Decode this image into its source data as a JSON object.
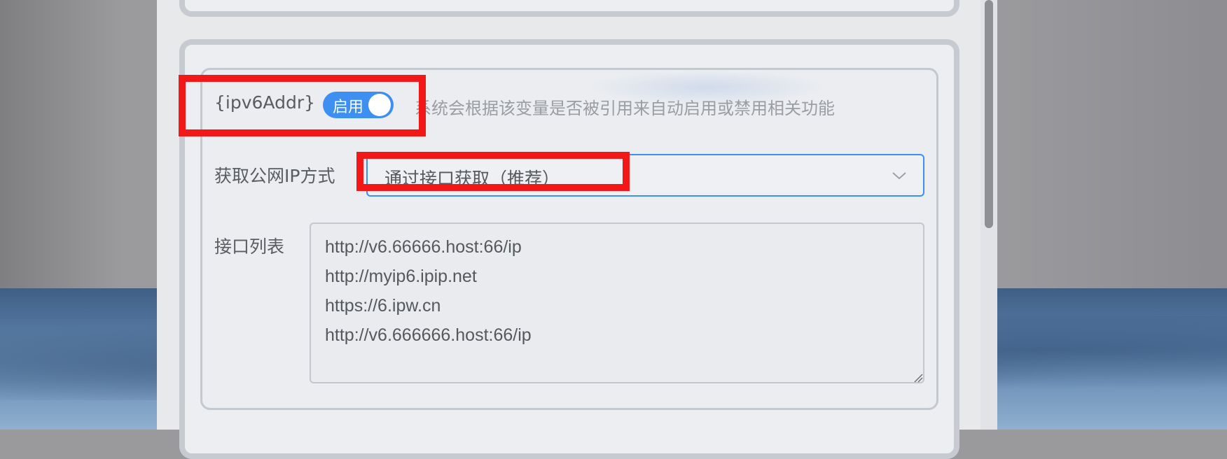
{
  "ipv6_section": {
    "variable_label": "{ipv6Addr}",
    "toggle": {
      "label": "启用",
      "enabled": true
    },
    "hint": "系统会根据该变量是否被引用来自动启用或禁用相关功能",
    "fetch_method": {
      "label": "获取公网IP方式",
      "selected": "通过接口获取（推荐）"
    },
    "api_list": {
      "label": "接口列表",
      "value": "http://v6.66666.host:66/ip\nhttp://myip6.ipip.net\nhttps://6.ipw.cn\nhttp://v6.666666.host:66/ip"
    }
  },
  "colors": {
    "accent": "#3d8ff2",
    "highlight": "#f21818"
  },
  "icons": {
    "select_arrow": "chevron-down-icon",
    "textarea_resize": "resize-grip-icon"
  }
}
